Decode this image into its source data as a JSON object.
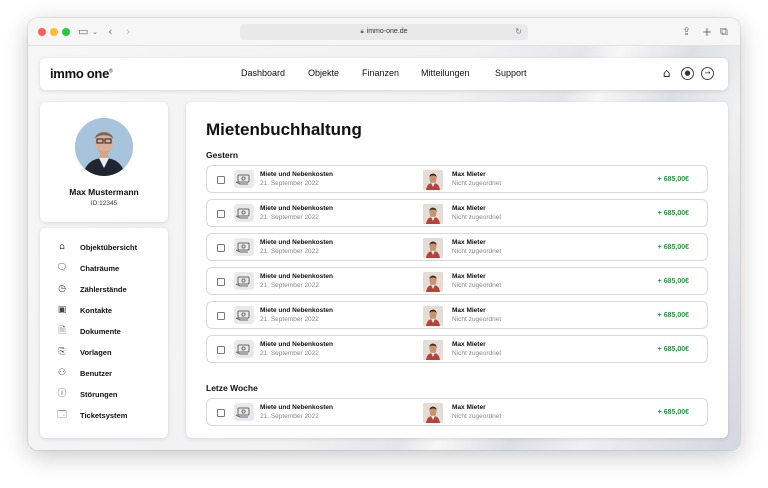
{
  "browser": {
    "url": "immo-one.de",
    "traffic_lights": [
      "#ff5f57",
      "#febc2e",
      "#28c840"
    ]
  },
  "navbar": {
    "logo": "immo one",
    "logo_mark": "®",
    "links": [
      "Dashboard",
      "Objekte",
      "Finanzen",
      "Mitteilungen",
      "Support"
    ],
    "icons": [
      "home-icon",
      "user-icon",
      "logout-icon"
    ]
  },
  "profile": {
    "name": "Max Mustermann",
    "id": "ID:12345"
  },
  "menu": {
    "items": [
      {
        "label": "Objektübersicht",
        "icon": "house-icon"
      },
      {
        "label": "Chaträume",
        "icon": "chat-icon"
      },
      {
        "label": "Zählerstände",
        "icon": "gauge-icon"
      },
      {
        "label": "Kontakte",
        "icon": "contacts-icon"
      },
      {
        "label": "Dokumente",
        "icon": "document-icon"
      },
      {
        "label": "Vorlagen",
        "icon": "template-icon"
      },
      {
        "label": "Benutzer",
        "icon": "users-icon"
      },
      {
        "label": "Störungen",
        "icon": "alert-icon"
      },
      {
        "label": "Ticketsystem",
        "icon": "ticket-icon"
      }
    ]
  },
  "main": {
    "title": "Mietenbuchhaltung",
    "sections": [
      {
        "label": "Gestern",
        "rows": [
          {
            "title": "Miete und Nebenkosten",
            "date": "21. September 2022",
            "tenant": "Max Mieter",
            "status": "Nicht zugeordnet",
            "amount": "+ 685,00€"
          },
          {
            "title": "Miete und Nebenkosten",
            "date": "21. September 2022",
            "tenant": "Max Mieter",
            "status": "Nicht zugeordnet",
            "amount": "+ 685,00€"
          },
          {
            "title": "Miete und Nebenkosten",
            "date": "21. September 2022",
            "tenant": "Max Mieter",
            "status": "Nicht zugeordnet",
            "amount": "+ 685,00€"
          },
          {
            "title": "Miete und Nebenkosten",
            "date": "21. September 2022",
            "tenant": "Max Mieter",
            "status": "Nicht zugeordnet",
            "amount": "+ 685,00€"
          },
          {
            "title": "Miete und Nebenkosten",
            "date": "21. September 2022",
            "tenant": "Max Mieter",
            "status": "Nicht zugeordnet",
            "amount": "+ 685,00€"
          },
          {
            "title": "Miete und Nebenkosten",
            "date": "21. September 2022",
            "tenant": "Max Mieter",
            "status": "Nicht zugeordnet",
            "amount": "+ 685,00€"
          }
        ]
      },
      {
        "label": "Letze Woche",
        "rows": [
          {
            "title": "Miete und Nebenkosten",
            "date": "21. September 2022",
            "tenant": "Max Mieter",
            "status": "Nicht zugeordnet",
            "amount": "+ 685,00€"
          }
        ]
      }
    ]
  },
  "colors": {
    "accent_green": "#1aa33b"
  }
}
